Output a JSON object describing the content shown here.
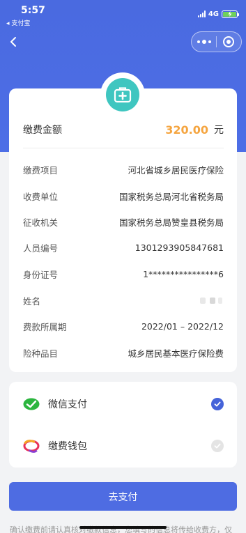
{
  "status_bar": {
    "time": "5:57",
    "back_app": "◂ 支付宝",
    "network": "4G",
    "battery_color": "#6fd15a"
  },
  "nav": {
    "back_icon": "chevron-left-icon",
    "more_icon": "more-dots-icon",
    "close_icon": "target-circle-icon"
  },
  "colors": {
    "brand": "#4d6ee6",
    "badge": "#3fc6c0",
    "amount": "#f5a540"
  },
  "header_icon": "medical-kit-icon",
  "amount": {
    "label": "缴费金额",
    "value": "320.00",
    "unit": "元"
  },
  "details": [
    {
      "label": "缴费项目",
      "value": "河北省城乡居民医疗保险"
    },
    {
      "label": "收费单位",
      "value": "国家税务总局河北省税务局"
    },
    {
      "label": "征收机关",
      "value": "国家税务总局赞皇县税务局"
    },
    {
      "label": "人员编号",
      "value": "1301293905847681"
    },
    {
      "label": "身份证号",
      "value": "1****************6"
    },
    {
      "label": "姓名",
      "value": ""
    },
    {
      "label": "费款所属期",
      "value": "2022/01 – 2022/12"
    },
    {
      "label": "险种品目",
      "value": "城乡居民基本医疗保险费"
    }
  ],
  "payment_methods": [
    {
      "label": "微信支付",
      "icon": "wechat-pay-icon",
      "selected": true
    },
    {
      "label": "缴费钱包",
      "icon": "payment-wallet-icon",
      "selected": false
    }
  ],
  "submit_label": "去支付",
  "notice": "确认缴费前请认真核对缴款信息，您填写的信息将传给收费方，仅"
}
